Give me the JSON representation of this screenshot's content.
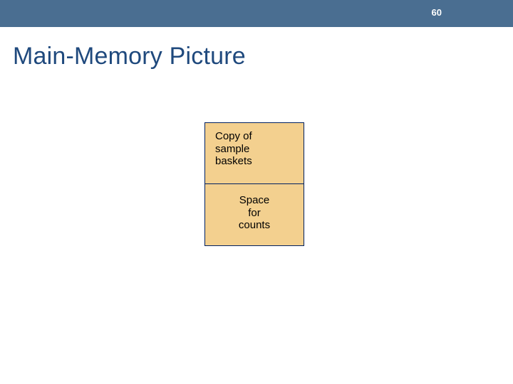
{
  "header": {
    "slide_number": "60"
  },
  "title": "Main-Memory Picture",
  "diagram": {
    "cells": [
      {
        "line1": "Copy of",
        "line2": "sample",
        "line3": "baskets"
      },
      {
        "line1": "Space",
        "line2": "for",
        "line3": "counts"
      }
    ]
  }
}
